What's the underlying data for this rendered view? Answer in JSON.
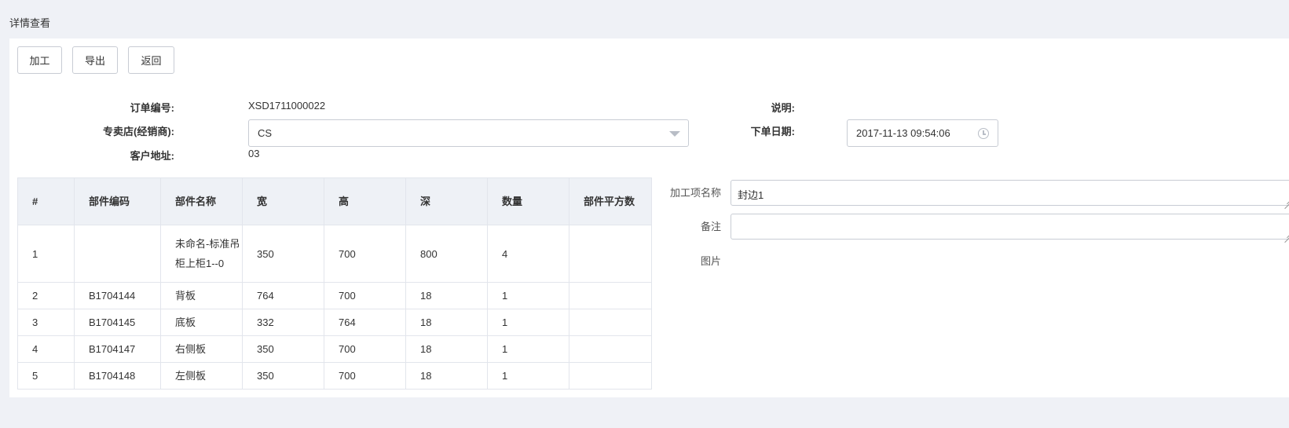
{
  "page": {
    "title": "详情查看"
  },
  "toolbar": {
    "process_label": "加工",
    "export_label": "导出",
    "back_label": "返回"
  },
  "form": {
    "order_no_label": "订单编号:",
    "order_no_value": "XSD1711000022",
    "store_label": "专卖店(经销商):",
    "store_value": "CS",
    "address_label": "客户地址:",
    "address_value": "03",
    "note_label": "说明:",
    "date_label": "下单日期:",
    "date_value": "2017-11-13 09:54:06"
  },
  "table": {
    "headers": [
      "#",
      "部件编码",
      "部件名称",
      "宽",
      "高",
      "深",
      "数量",
      "部件平方数"
    ],
    "rows": [
      [
        "1",
        "",
        "未命名-标准吊柜上柜1--0",
        "350",
        "700",
        "800",
        "4",
        ""
      ],
      [
        "2",
        "B1704144",
        "背板",
        "764",
        "700",
        "18",
        "1",
        ""
      ],
      [
        "3",
        "B1704145",
        "底板",
        "332",
        "764",
        "18",
        "1",
        ""
      ],
      [
        "4",
        "B1704147",
        "右侧板",
        "350",
        "700",
        "18",
        "1",
        ""
      ],
      [
        "5",
        "B1704148",
        "左侧板",
        "350",
        "700",
        "18",
        "1",
        ""
      ]
    ]
  },
  "side": {
    "process_name_label": "加工项名称",
    "process_name_value": "封边1",
    "remark_label": "备注",
    "remark_value": "",
    "image_label": "图片"
  },
  "icons": {
    "select_caret": "chevron-down-icon",
    "date_clock": "clock-icon"
  },
  "colors": {
    "page_bg": "#eff1f6",
    "panel_bg": "#ffffff",
    "table_header_bg": "#eef1f6",
    "border": "#c8ccd4"
  }
}
